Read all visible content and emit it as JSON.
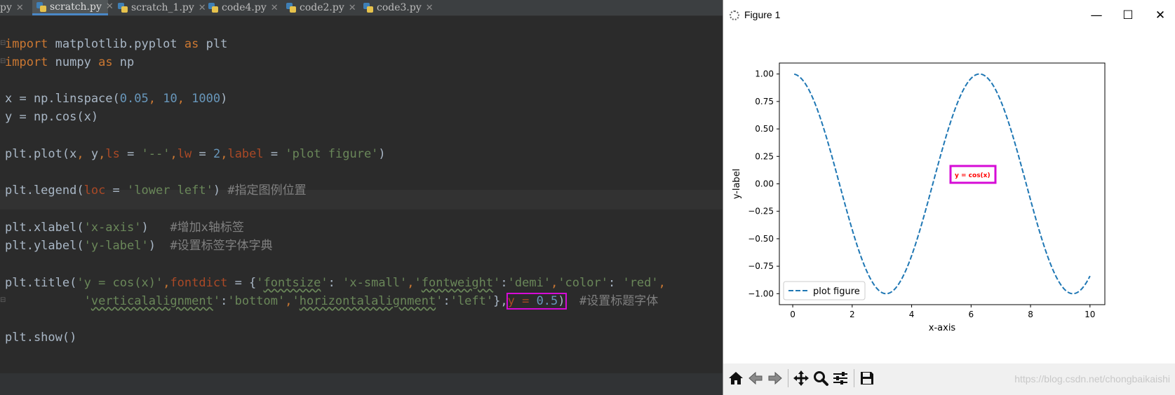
{
  "tabs": [
    {
      "label": "py",
      "active": false
    },
    {
      "label": "scratch.py",
      "active": true
    },
    {
      "label": "scratch_1.py",
      "active": false
    },
    {
      "label": "code4.py",
      "active": false
    },
    {
      "label": "code2.py",
      "active": false
    },
    {
      "label": "code3.py",
      "active": false
    }
  ],
  "code": {
    "l1_kw": "import",
    "l1_rest": " matplotlib.pyplot ",
    "l1_as": "as",
    "l1_alias": " plt",
    "l2_kw": "import",
    "l2_rest": " numpy ",
    "l2_as": "as",
    "l2_alias": " np",
    "l3_a": "x = np.linspace(",
    "l3_n1": "0.05",
    "l3_c1": ", ",
    "l3_n2": "10",
    "l3_c2": ", ",
    "l3_n3": "1000",
    "l3_b": ")",
    "l4": "y = np.cos(x)",
    "l5_a": "plt.plot(x",
    "l5_c1": ",",
    "l5_b": " y",
    "l5_c2": ",",
    "l5_p1": "ls",
    "l5_eq1": " = ",
    "l5_s1": "'--'",
    "l5_c3": ",",
    "l5_p2": "lw",
    "l5_eq2": " = ",
    "l5_n1": "2",
    "l5_c4": ",",
    "l5_p3": "label",
    "l5_eq3": " = ",
    "l5_s2": "'plot figure'",
    "l5_b2": ")",
    "l6_a": "plt.legend(",
    "l6_p": "loc",
    "l6_eq": " = ",
    "l6_s": "'lower left'",
    "l6_b": ") ",
    "l6_cm": "#指定图例位置",
    "l7_a": "plt.xlabel(",
    "l7_s": "'x-axis'",
    "l7_b": ")   ",
    "l7_cm": "#增加x轴标签",
    "l8_a": "plt.ylabel(",
    "l8_s": "'y-label'",
    "l8_b": ")  ",
    "l8_cm": "#设置标签字体字典",
    "l9_a": "plt.title(",
    "l9_s1": "'y = cos(x)'",
    "l9_c1": ",",
    "l9_p1": "fontdict",
    "l9_eq": " = {",
    "l9_q1": "'",
    "l9_k1": "fontsize",
    "l9_q2": "'",
    "l9_col1": ": ",
    "l9_v1": "'x-small'",
    "l9_c2": ",",
    "l9_q3": "'",
    "l9_k2": "fontweight",
    "l9_q4": "'",
    "l9_col2": ":",
    "l9_v2": "'demi'",
    "l9_c3": ",",
    "l9_k3": "'color'",
    "l9_col3": ": ",
    "l9_v3": "'red'",
    "l9_c4": ",",
    "l10_ind": "           ",
    "l10_q1": "'",
    "l10_k1": "verticalalignment",
    "l10_q2": "'",
    "l10_col1": ":",
    "l10_v1": "'bottom'",
    "l10_c1": ",",
    "l10_q3": "'",
    "l10_k2": "horizontalalignment",
    "l10_q4": "'",
    "l10_col2": ":",
    "l10_v2": "'left'",
    "l10_b": "},",
    "l10_y": "y = ",
    "l10_yn": "0.5",
    "l10_b2": ")",
    "l10_sp": "  ",
    "l10_cm": "#设置标题字体",
    "l11": "plt.show()"
  },
  "figure": {
    "title": "Figure 1",
    "minimize": "—",
    "maximize": "☐",
    "close": "✕",
    "watermark": "https://blog.csdn.net/chongbaikaishi"
  },
  "toolbar_icons": [
    "home-icon",
    "back-arrow-icon",
    "forward-arrow-icon",
    "pan-icon",
    "zoom-icon",
    "subplots-config-icon",
    "save-icon"
  ],
  "chart_data": {
    "type": "line",
    "title": "y = cos(x)",
    "title_color": "#ff0000",
    "xlabel": "x-axis",
    "ylabel": "y-label",
    "xlim": [
      -0.45,
      10.5
    ],
    "ylim": [
      -1.1,
      1.1
    ],
    "xticks": [
      0,
      2,
      4,
      6,
      8,
      10
    ],
    "xtick_labels": [
      "0",
      "2",
      "4",
      "6",
      "8",
      "10"
    ],
    "yticks": [
      1.0,
      0.75,
      0.5,
      0.25,
      0.0,
      -0.25,
      -0.5,
      -0.75,
      -1.0
    ],
    "ytick_labels": [
      "1.00",
      "0.75",
      "0.50",
      "0.25",
      "0.00",
      "−0.25",
      "−0.50",
      "−0.75",
      "−1.00"
    ],
    "series": [
      {
        "name": "plot figure",
        "function": "cos",
        "x_start": 0.05,
        "x_end": 10,
        "n_points": 1000,
        "color": "#1f77b4",
        "linestyle": "dashed",
        "linewidth": 2
      }
    ],
    "legend": {
      "location": "lower left",
      "entries": [
        "plot figure"
      ]
    },
    "grid": false
  }
}
